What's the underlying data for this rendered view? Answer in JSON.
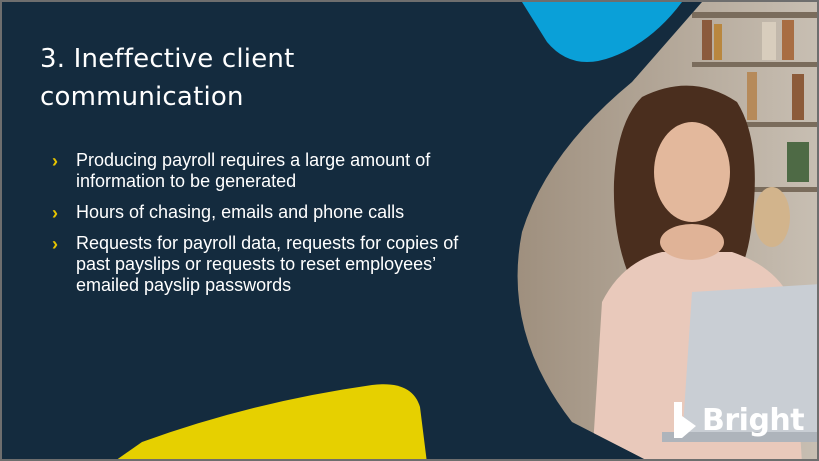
{
  "slide": {
    "title": "3. Ineffective client communication",
    "bullets": [
      "Producing payroll requires a large amount of information to be generated",
      "Hours of chasing, emails and phone calls",
      "Requests for payroll data, requests for copies of past payslips or requests to reset employees’ emailed payslip passwords"
    ],
    "chevron_glyph": "›",
    "logo_text": "Bright"
  },
  "colors": {
    "background": "#142b3e",
    "accent_yellow": "#e6d000",
    "accent_blue": "#0aa0d8",
    "bullet_chevron": "#e6c400",
    "text": "#ffffff"
  },
  "icons": {
    "bullet": "chevron-right-icon",
    "logo": "bright-logo-icon"
  }
}
